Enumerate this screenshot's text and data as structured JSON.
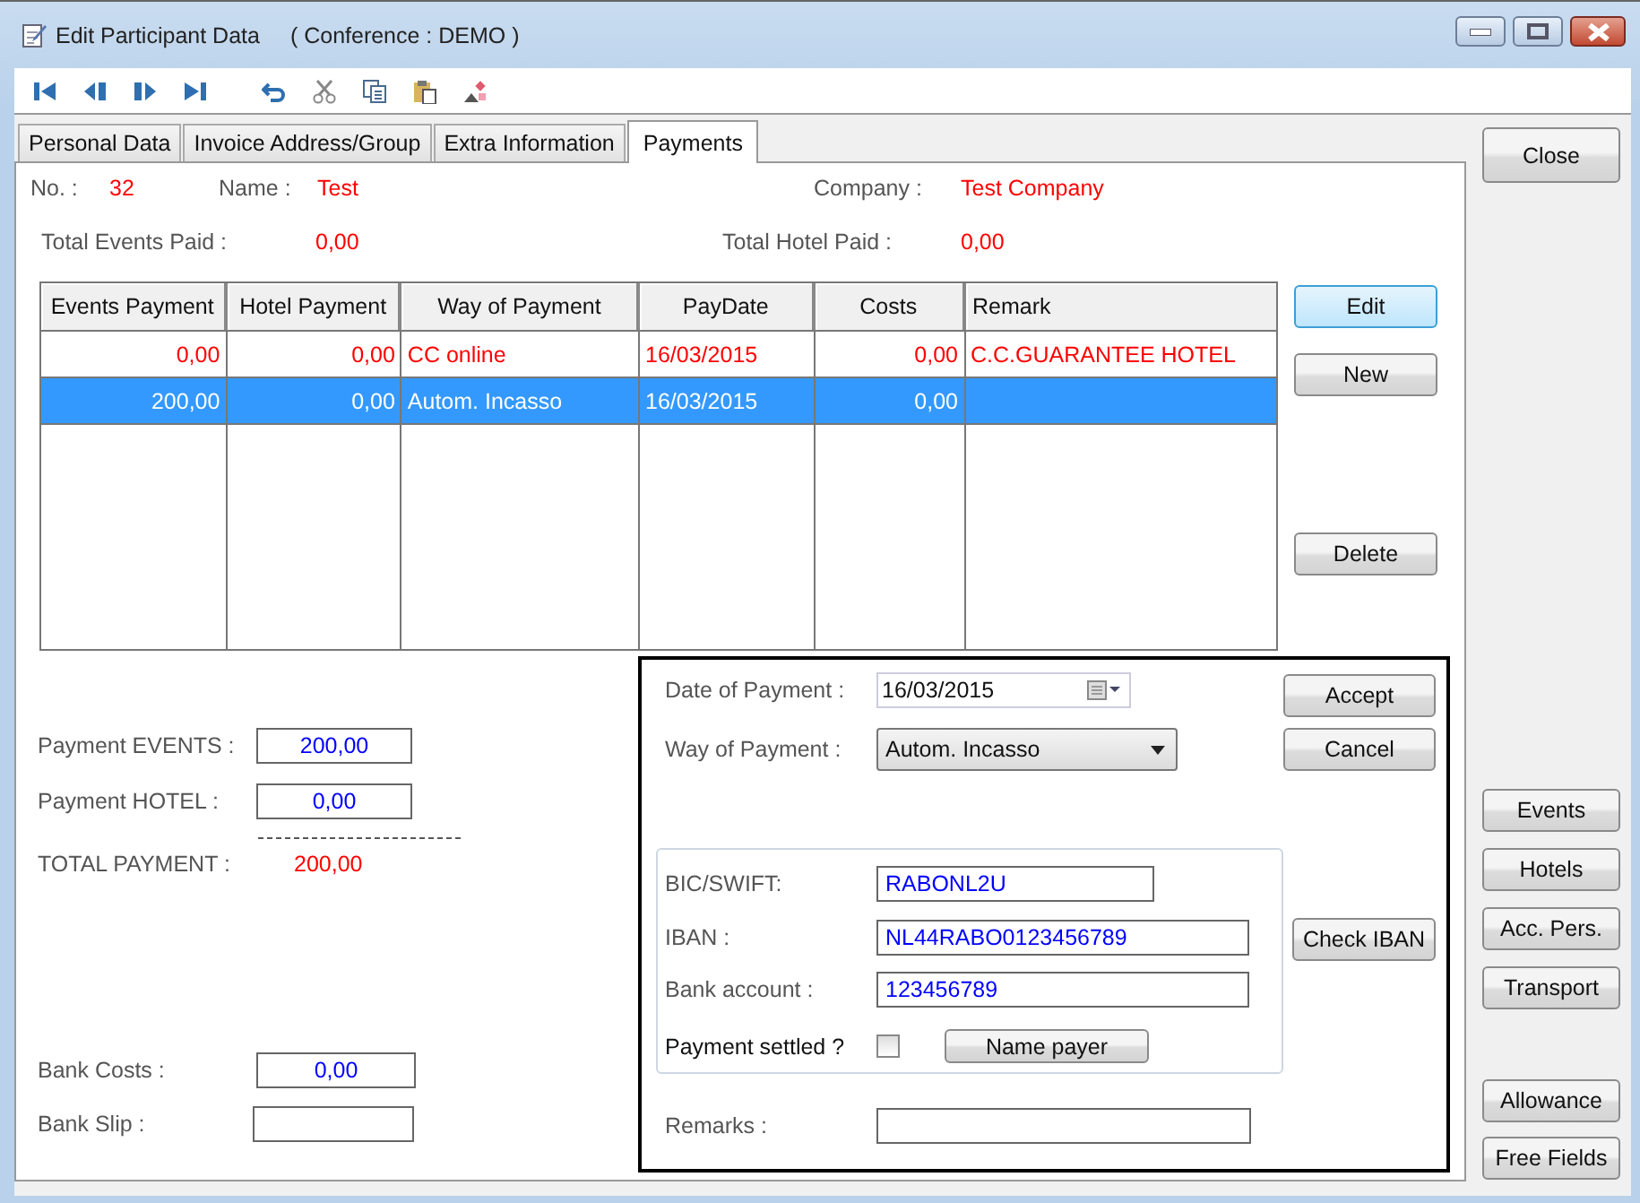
{
  "window": {
    "title": "Edit Participant Data",
    "subtitle": "( Conference : DEMO )"
  },
  "tabs": [
    {
      "label": "Personal Data",
      "selected": false
    },
    {
      "label": "Invoice Address/Group",
      "selected": false
    },
    {
      "label": "Extra Information",
      "selected": false
    },
    {
      "label": "Payments",
      "selected": true
    }
  ],
  "header": {
    "no_label": "No. :",
    "no": "32",
    "name_label": "Name :",
    "name": "Test",
    "company_label": "Company :",
    "company": "Test Company",
    "events_paid_label": "Total Events Paid :",
    "events_paid": "0,00",
    "hotel_paid_label": "Total Hotel Paid :",
    "hotel_paid": "0,00"
  },
  "table": {
    "columns": [
      "Events Payment",
      "Hotel Payment",
      "Way of Payment",
      "PayDate",
      "Costs",
      "Remark"
    ],
    "rows": [
      {
        "cells": [
          "0,00",
          "0,00",
          "CC online",
          "16/03/2015",
          "0,00",
          "C.C.GUARANTEE HOTEL"
        ],
        "flagged": true,
        "selected": false
      },
      {
        "cells": [
          "200,00",
          "0,00",
          "Autom. Incasso",
          "16/03/2015",
          "0,00",
          ""
        ],
        "flagged": false,
        "selected": true
      }
    ]
  },
  "table_buttons": [
    {
      "label": "Edit",
      "focused": true
    },
    {
      "label": "New",
      "focused": false
    },
    {
      "label": "Delete",
      "focused": false
    }
  ],
  "totals": {
    "events_label": "Payment EVENTS :",
    "events": "200,00",
    "hotel_label": "Payment HOTEL :",
    "hotel": "0,00",
    "total_label": "TOTAL PAYMENT :",
    "total": "200,00",
    "bank_costs_label": "Bank Costs :",
    "bank_costs": "0,00",
    "bank_slip_label": "Bank Slip :"
  },
  "payment_form": {
    "date_label": "Date of Payment :",
    "date": "16/03/2015",
    "way_label": "Way of Payment :",
    "way": "Autom. Incasso",
    "accept": "Accept",
    "cancel": "Cancel",
    "bic_label": "BIC/SWIFT:",
    "bic": "RABONL2U",
    "iban_label": "IBAN :",
    "iban": "NL44RABO0123456789",
    "account_label": "Bank account :",
    "account": "123456789",
    "settled_label": "Payment settled ?",
    "settled": false,
    "name_payer": "Name payer",
    "check_iban": "Check IBAN",
    "remarks_label": "Remarks :"
  },
  "side_buttons": {
    "close": "Close",
    "group1": [
      "Events",
      "Hotels",
      "Acc. Pers.",
      "Transport"
    ],
    "group2": [
      "Allowance",
      "Free Fields"
    ]
  }
}
